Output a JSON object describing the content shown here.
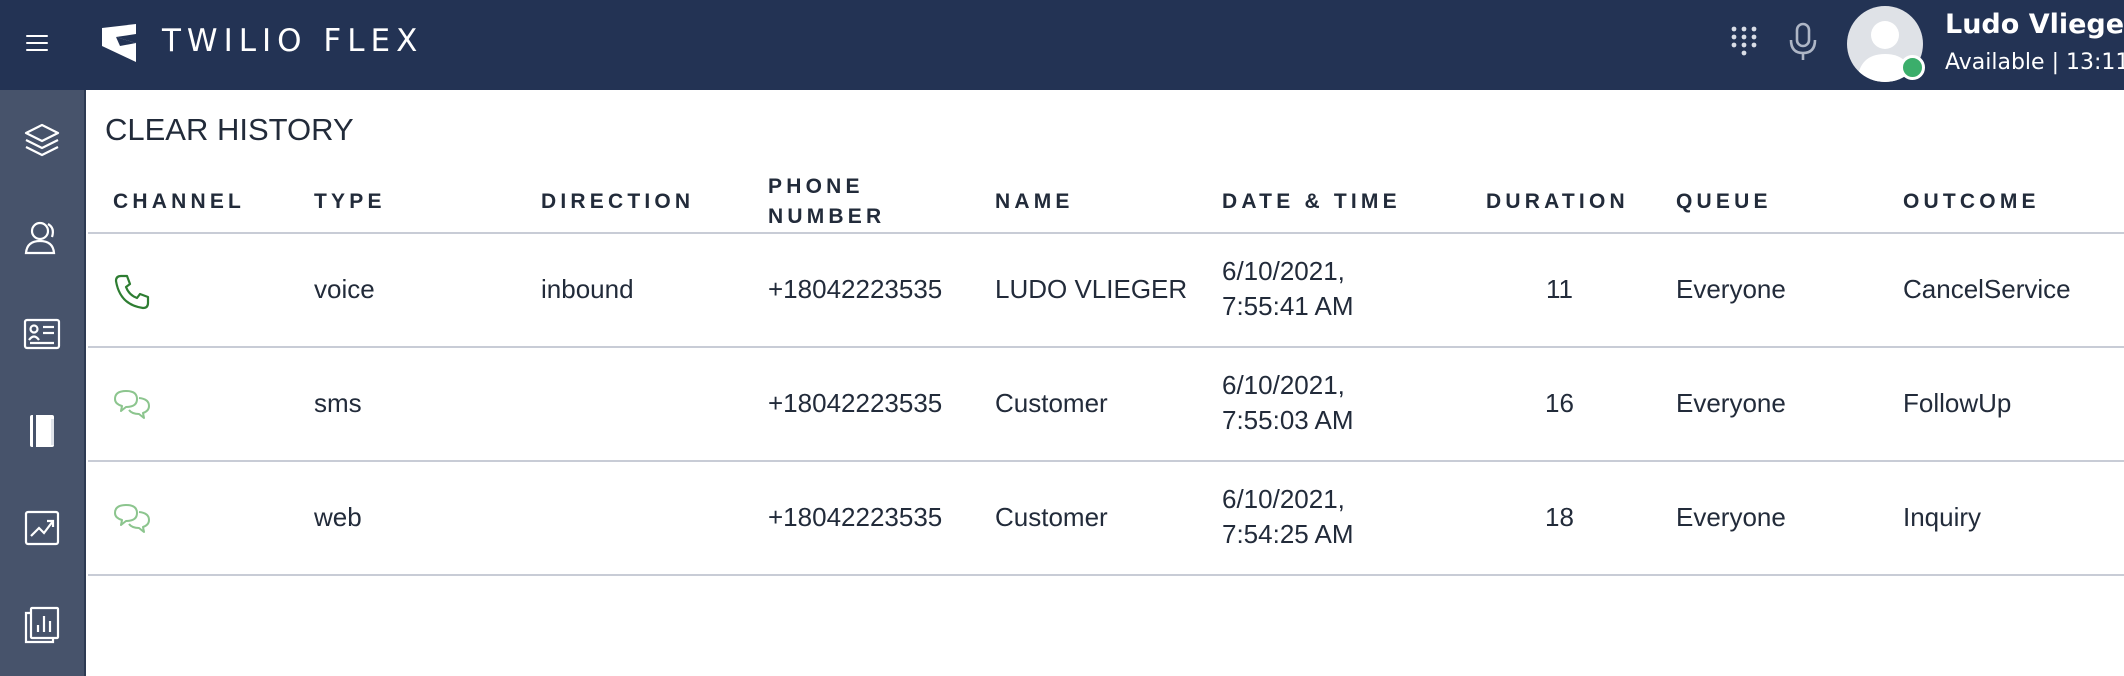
{
  "header": {
    "brand": "TWILIO FLEX",
    "user_name": "Ludo Vlieger",
    "user_status": "Available | 13:11",
    "presence_color": "#3bae6b",
    "icons": [
      "menu-icon",
      "twilio-flex-logo",
      "dialpad-icon",
      "microphone-icon",
      "avatar"
    ]
  },
  "sidebar": {
    "items": [
      {
        "icon": "layers-icon",
        "id": "agent-desktop"
      },
      {
        "icon": "person-icon",
        "id": "teams"
      },
      {
        "icon": "contact-card-icon",
        "id": "contacts"
      },
      {
        "icon": "notebook-icon",
        "id": "history"
      },
      {
        "icon": "trend-chart-icon",
        "id": "insights"
      },
      {
        "icon": "bar-report-icon",
        "id": "reports"
      }
    ]
  },
  "history": {
    "clear_label": "CLEAR HISTORY",
    "columns": {
      "channel": "CHANNEL",
      "type": "TYPE",
      "direction": "DIRECTION",
      "phone_line1": "PHONE",
      "phone_line2": "NUMBER",
      "name": "NAME",
      "datetime": "DATE & TIME",
      "duration": "DURATION",
      "queue": "QUEUE",
      "outcome": "OUTCOME"
    },
    "rows": [
      {
        "channel_icon": "phone-icon",
        "type": "voice",
        "direction": "inbound",
        "phone": "+18042223535",
        "name": "LUDO VLIEGER",
        "date": "6/10/2021,",
        "time": "7:55:41 AM",
        "duration": "11",
        "queue": "Everyone",
        "outcome": "CancelService"
      },
      {
        "channel_icon": "chat-icon",
        "type": "sms",
        "direction": "",
        "phone": "+18042223535",
        "name": "Customer",
        "date": "6/10/2021,",
        "time": "7:55:03 AM",
        "duration": "16",
        "queue": "Everyone",
        "outcome": "FollowUp"
      },
      {
        "channel_icon": "chat-icon",
        "type": "web",
        "direction": "",
        "phone": "+18042223535",
        "name": "Customer",
        "date": "6/10/2021,",
        "time": "7:54:25 AM",
        "duration": "18",
        "queue": "Everyone",
        "outcome": "Inquiry"
      }
    ]
  },
  "colors": {
    "topbar": "#233354",
    "sidebar": "#47536b",
    "voice_icon": "#2e7d32",
    "chat_icon": "#8cc58e",
    "divider": "#c8ccd6"
  }
}
